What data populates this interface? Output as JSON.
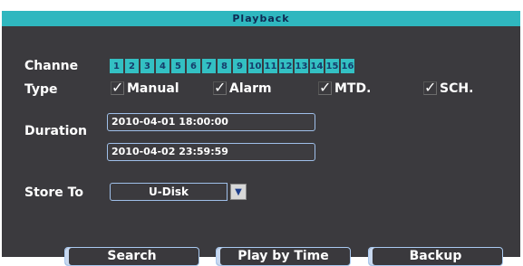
{
  "title": "Playback",
  "labels": {
    "channel": "Channe",
    "type": "Type",
    "duration": "Duration",
    "store_to": "Store To"
  },
  "channels": [
    "1",
    "2",
    "3",
    "4",
    "5",
    "6",
    "7",
    "8",
    "9",
    "10",
    "11",
    "12",
    "13",
    "14",
    "15",
    "16"
  ],
  "types": [
    {
      "label": "Manual",
      "checked": true
    },
    {
      "label": "Alarm",
      "checked": true
    },
    {
      "label": "MTD.",
      "checked": true
    },
    {
      "label": "SCH.",
      "checked": true
    }
  ],
  "check_mark": "✓",
  "duration": {
    "start": "2010-04-01  18:00:00",
    "end": "2010-04-02  23:59:59"
  },
  "store_to": {
    "value": "U-Disk",
    "arrow": "▼"
  },
  "buttons": {
    "search": "Search",
    "play_by_time": "Play by Time",
    "backup": "Backup"
  },
  "colors": {
    "title_bar": "#2fb7bf",
    "panel": "#3b3a3e",
    "channel_chip": "#33c0c3",
    "field_border": "#9fbfe9"
  },
  "icons": {
    "check": "check-icon",
    "dropdown": "chevron-down-icon"
  }
}
